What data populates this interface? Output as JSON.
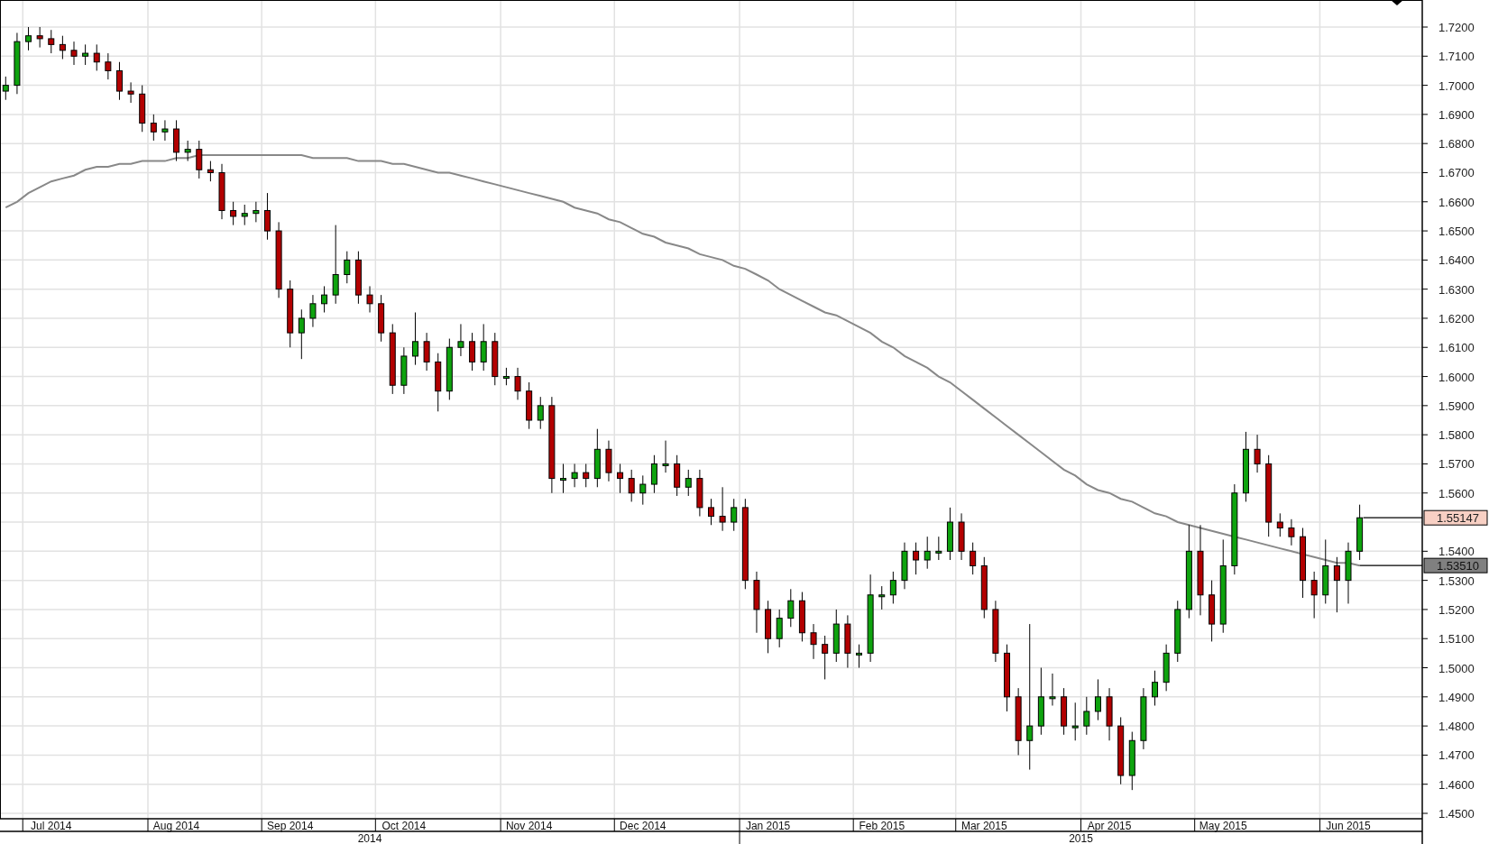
{
  "chart": {
    "chart_data": {
      "type": "candlestick",
      "categories": [
        null,
        null,
        null,
        null,
        "Jul 2014",
        null,
        null,
        null,
        null,
        null,
        null,
        null,
        null,
        null,
        null,
        "Aug 2014",
        null,
        null,
        null,
        null,
        null,
        null,
        null,
        null,
        null,
        "Sep 2014",
        null,
        null,
        null,
        null,
        null,
        null,
        null,
        null,
        null,
        "Oct 2014",
        null,
        null,
        null,
        null,
        null,
        null,
        null,
        null,
        null,
        null,
        "Nov 2014",
        null,
        null,
        null,
        null,
        null,
        null,
        null,
        null,
        null,
        "Dec 2014",
        null,
        null,
        null,
        null,
        null,
        null,
        null,
        null,
        null,
        null,
        "Jan 2015",
        null,
        null,
        null,
        null,
        null,
        null,
        null,
        null,
        null,
        "Feb 2015",
        null,
        null,
        null,
        null,
        null,
        null,
        null,
        null,
        "Mar 2015",
        null,
        null,
        null,
        null,
        null,
        null,
        null,
        null,
        null,
        null,
        "Apr 2015",
        null,
        null,
        null,
        null,
        null,
        null,
        null,
        null,
        null,
        "May 2015",
        null,
        null,
        null,
        null,
        null,
        null,
        null,
        null,
        null,
        null,
        "Jun 2015",
        null,
        null,
        null,
        null,
        null,
        null
      ],
      "grid": true,
      "ohlc": [
        [
          1.698,
          1.703,
          1.695,
          1.7
        ],
        [
          1.7,
          1.718,
          1.697,
          1.715
        ],
        [
          1.715,
          1.72,
          1.712,
          1.717
        ],
        [
          1.717,
          1.72,
          1.713,
          1.716
        ],
        [
          1.716,
          1.719,
          1.711,
          1.714
        ],
        [
          1.714,
          1.717,
          1.709,
          1.712
        ],
        [
          1.712,
          1.715,
          1.707,
          1.71
        ],
        [
          1.71,
          1.714,
          1.707,
          1.711
        ],
        [
          1.711,
          1.714,
          1.705,
          1.708
        ],
        [
          1.708,
          1.711,
          1.702,
          1.705
        ],
        [
          1.705,
          1.708,
          1.695,
          1.698
        ],
        [
          1.698,
          1.701,
          1.694,
          1.697
        ],
        [
          1.697,
          1.7,
          1.684,
          1.687
        ],
        [
          1.687,
          1.69,
          1.681,
          1.684
        ],
        [
          1.684,
          1.688,
          1.681,
          1.685
        ],
        [
          1.685,
          1.688,
          1.674,
          1.677
        ],
        [
          1.677,
          1.681,
          1.674,
          1.678
        ],
        [
          1.678,
          1.681,
          1.668,
          1.671
        ],
        [
          1.671,
          1.674,
          1.667,
          1.67
        ],
        [
          1.67,
          1.673,
          1.654,
          1.657
        ],
        [
          1.657,
          1.66,
          1.652,
          1.655
        ],
        [
          1.655,
          1.659,
          1.652,
          1.656
        ],
        [
          1.656,
          1.66,
          1.653,
          1.657
        ],
        [
          1.657,
          1.663,
          1.647,
          1.65
        ],
        [
          1.65,
          1.653,
          1.627,
          1.63
        ],
        [
          1.63,
          1.633,
          1.61,
          1.615
        ],
        [
          1.615,
          1.623,
          1.606,
          1.62
        ],
        [
          1.62,
          1.628,
          1.617,
          1.625
        ],
        [
          1.625,
          1.631,
          1.622,
          1.628
        ],
        [
          1.628,
          1.652,
          1.625,
          1.635
        ],
        [
          1.635,
          1.643,
          1.632,
          1.64
        ],
        [
          1.64,
          1.643,
          1.625,
          1.628
        ],
        [
          1.628,
          1.631,
          1.622,
          1.625
        ],
        [
          1.625,
          1.628,
          1.612,
          1.615
        ],
        [
          1.615,
          1.618,
          1.594,
          1.597
        ],
        [
          1.597,
          1.61,
          1.594,
          1.607
        ],
        [
          1.607,
          1.622,
          1.604,
          1.612
        ],
        [
          1.612,
          1.615,
          1.602,
          1.605
        ],
        [
          1.605,
          1.608,
          1.588,
          1.595
        ],
        [
          1.595,
          1.613,
          1.592,
          1.61
        ],
        [
          1.61,
          1.618,
          1.607,
          1.612
        ],
        [
          1.612,
          1.615,
          1.602,
          1.605
        ],
        [
          1.605,
          1.618,
          1.602,
          1.612
        ],
        [
          1.612,
          1.615,
          1.597,
          1.6
        ],
        [
          1.6,
          1.603,
          1.597,
          1.6
        ],
        [
          1.6,
          1.603,
          1.592,
          1.595
        ],
        [
          1.595,
          1.598,
          1.582,
          1.585
        ],
        [
          1.585,
          1.593,
          1.582,
          1.59
        ],
        [
          1.59,
          1.593,
          1.56,
          1.565
        ],
        [
          1.565,
          1.57,
          1.56,
          1.565
        ],
        [
          1.565,
          1.57,
          1.562,
          1.567
        ],
        [
          1.567,
          1.57,
          1.562,
          1.565
        ],
        [
          1.565,
          1.582,
          1.562,
          1.575
        ],
        [
          1.575,
          1.578,
          1.564,
          1.567
        ],
        [
          1.567,
          1.57,
          1.56,
          1.565
        ],
        [
          1.565,
          1.568,
          1.557,
          1.56
        ],
        [
          1.56,
          1.566,
          1.556,
          1.563
        ],
        [
          1.563,
          1.573,
          1.56,
          1.57
        ],
        [
          1.57,
          1.578,
          1.567,
          1.57
        ],
        [
          1.57,
          1.573,
          1.559,
          1.562
        ],
        [
          1.562,
          1.568,
          1.559,
          1.565
        ],
        [
          1.565,
          1.568,
          1.552,
          1.555
        ],
        [
          1.555,
          1.558,
          1.549,
          1.552
        ],
        [
          1.552,
          1.562,
          1.547,
          1.55
        ],
        [
          1.55,
          1.558,
          1.547,
          1.555
        ],
        [
          1.555,
          1.558,
          1.527,
          1.53
        ],
        [
          1.53,
          1.533,
          1.512,
          1.52
        ],
        [
          1.52,
          1.523,
          1.505,
          1.51
        ],
        [
          1.51,
          1.52,
          1.507,
          1.517
        ],
        [
          1.517,
          1.527,
          1.514,
          1.523
        ],
        [
          1.523,
          1.526,
          1.509,
          1.512
        ],
        [
          1.512,
          1.515,
          1.503,
          1.508
        ],
        [
          1.508,
          1.511,
          1.496,
          1.505
        ],
        [
          1.505,
          1.52,
          1.502,
          1.515
        ],
        [
          1.515,
          1.518,
          1.5,
          1.505
        ],
        [
          1.505,
          1.508,
          1.5,
          1.505
        ],
        [
          1.505,
          1.532,
          1.502,
          1.525
        ],
        [
          1.525,
          1.528,
          1.52,
          1.525
        ],
        [
          1.525,
          1.533,
          1.522,
          1.53
        ],
        [
          1.53,
          1.543,
          1.527,
          1.54
        ],
        [
          1.54,
          1.543,
          1.532,
          1.537
        ],
        [
          1.537,
          1.545,
          1.534,
          1.54
        ],
        [
          1.54,
          1.545,
          1.537,
          1.54
        ],
        [
          1.54,
          1.555,
          1.537,
          1.55
        ],
        [
          1.55,
          1.553,
          1.537,
          1.54
        ],
        [
          1.54,
          1.543,
          1.532,
          1.535
        ],
        [
          1.535,
          1.538,
          1.517,
          1.52
        ],
        [
          1.52,
          1.523,
          1.502,
          1.505
        ],
        [
          1.505,
          1.508,
          1.485,
          1.49
        ],
        [
          1.49,
          1.493,
          1.47,
          1.475
        ],
        [
          1.475,
          1.515,
          1.465,
          1.48
        ],
        [
          1.48,
          1.5,
          1.477,
          1.49
        ],
        [
          1.49,
          1.498,
          1.487,
          1.49
        ],
        [
          1.49,
          1.493,
          1.477,
          1.48
        ],
        [
          1.48,
          1.488,
          1.475,
          1.48
        ],
        [
          1.48,
          1.49,
          1.477,
          1.485
        ],
        [
          1.485,
          1.496,
          1.482,
          1.49
        ],
        [
          1.49,
          1.493,
          1.475,
          1.48
        ],
        [
          1.48,
          1.483,
          1.46,
          1.463
        ],
        [
          1.463,
          1.478,
          1.458,
          1.475
        ],
        [
          1.475,
          1.493,
          1.472,
          1.49
        ],
        [
          1.49,
          1.499,
          1.487,
          1.495
        ],
        [
          1.495,
          1.508,
          1.492,
          1.505
        ],
        [
          1.505,
          1.523,
          1.502,
          1.52
        ],
        [
          1.52,
          1.549,
          1.517,
          1.54
        ],
        [
          1.54,
          1.549,
          1.518,
          1.525
        ],
        [
          1.525,
          1.53,
          1.509,
          1.515
        ],
        [
          1.515,
          1.544,
          1.512,
          1.535
        ],
        [
          1.535,
          1.563,
          1.532,
          1.56
        ],
        [
          1.56,
          1.581,
          1.557,
          1.575
        ],
        [
          1.575,
          1.58,
          1.567,
          1.57
        ],
        [
          1.57,
          1.573,
          1.545,
          1.55
        ],
        [
          1.55,
          1.553,
          1.545,
          1.548
        ],
        [
          1.548,
          1.551,
          1.542,
          1.545
        ],
        [
          1.545,
          1.548,
          1.524,
          1.53
        ],
        [
          1.53,
          1.533,
          1.517,
          1.525
        ],
        [
          1.525,
          1.544,
          1.522,
          1.535
        ],
        [
          1.535,
          1.538,
          1.519,
          1.53
        ],
        [
          1.53,
          1.543,
          1.522,
          1.54
        ],
        [
          1.54,
          1.556,
          1.537,
          1.5515
        ],
        null,
        null,
        null,
        null,
        null
      ],
      "series": [
        {
          "type": "line",
          "color": "#888888",
          "values": [
            1.658,
            1.66,
            1.663,
            1.665,
            1.667,
            1.668,
            1.669,
            1.671,
            1.672,
            1.672,
            1.673,
            1.673,
            1.674,
            1.674,
            1.674,
            1.675,
            1.675,
            1.676,
            1.676,
            1.676,
            1.676,
            1.676,
            1.676,
            1.676,
            1.676,
            1.676,
            1.676,
            1.675,
            1.675,
            1.675,
            1.675,
            1.674,
            1.674,
            1.674,
            1.673,
            1.673,
            1.672,
            1.671,
            1.67,
            1.67,
            1.669,
            1.668,
            1.667,
            1.666,
            1.665,
            1.664,
            1.663,
            1.662,
            1.661,
            1.66,
            1.658,
            1.657,
            1.656,
            1.654,
            1.653,
            1.651,
            1.649,
            1.648,
            1.646,
            1.645,
            1.644,
            1.642,
            1.641,
            1.64,
            1.638,
            1.637,
            1.635,
            1.633,
            1.63,
            1.628,
            1.626,
            1.624,
            1.622,
            1.621,
            1.619,
            1.617,
            1.615,
            1.612,
            1.61,
            1.607,
            1.605,
            1.603,
            1.6,
            1.598,
            1.595,
            1.592,
            1.589,
            1.586,
            1.583,
            1.58,
            1.577,
            1.574,
            1.571,
            1.568,
            1.566,
            1.563,
            1.561,
            1.56,
            1.558,
            1.557,
            1.555,
            1.553,
            1.552,
            1.55,
            1.549,
            1.548,
            1.547,
            1.546,
            1.545,
            1.544,
            1.543,
            1.542,
            1.541,
            1.54,
            1.539,
            1.538,
            1.537,
            1.536,
            1.536,
            1.5351,
            null,
            null,
            null,
            null,
            null
          ]
        }
      ],
      "ylim": [
        1.45,
        1.72
      ],
      "yticks": [
        {
          "value": 1.72,
          "label": "1.7200"
        },
        {
          "value": 1.71,
          "label": "1.7100"
        },
        {
          "value": 1.7,
          "label": "1.7000"
        },
        {
          "value": 1.69,
          "label": "1.6900"
        },
        {
          "value": 1.68,
          "label": "1.6800"
        },
        {
          "value": 1.67,
          "label": "1.6700"
        },
        {
          "value": 1.66,
          "label": "1.6600"
        },
        {
          "value": 1.65,
          "label": "1.6500"
        },
        {
          "value": 1.64,
          "label": "1.6400"
        },
        {
          "value": 1.63,
          "label": "1.6300"
        },
        {
          "value": 1.62,
          "label": "1.6200"
        },
        {
          "value": 1.61,
          "label": "1.6100"
        },
        {
          "value": 1.6,
          "label": "1.6000"
        },
        {
          "value": 1.59,
          "label": "1.5900"
        },
        {
          "value": 1.58,
          "label": "1.5800"
        },
        {
          "value": 1.57,
          "label": "1.5700"
        },
        {
          "value": 1.56,
          "label": "1.5600"
        },
        {
          "value": 1.54,
          "label": "1.5400"
        },
        {
          "value": 1.53,
          "label": "1.5300"
        },
        {
          "value": 1.52,
          "label": "1.5200"
        },
        {
          "value": 1.51,
          "label": "1.5100"
        },
        {
          "value": 1.5,
          "label": "1.5000"
        },
        {
          "value": 1.49,
          "label": "1.4900"
        },
        {
          "value": 1.48,
          "label": "1.4800"
        },
        {
          "value": 1.47,
          "label": "1.4700"
        },
        {
          "value": 1.46,
          "label": "1.4600"
        },
        {
          "value": 1.45,
          "label": "1.4500"
        }
      ]
    },
    "years": [
      "2014",
      "2015"
    ],
    "last_price_label": "1.55147",
    "average_label": "1.53510"
  }
}
